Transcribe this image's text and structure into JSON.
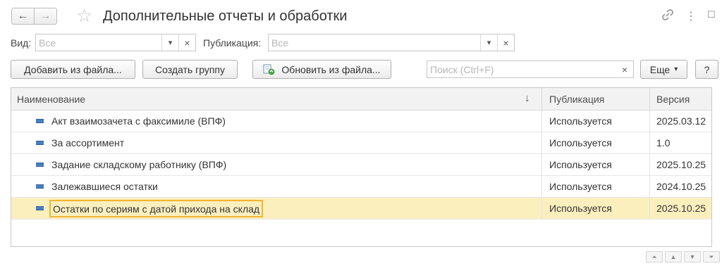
{
  "window": {
    "title": "Дополнительные отчеты и обработки",
    "back_icon": "←",
    "forward_icon": "→",
    "star_icon": "☆",
    "link_icon": "🔗",
    "menu_icon": "⋮",
    "restore_icon": "☐",
    "close_icon": "×"
  },
  "filters": {
    "view_label": "Вид:",
    "view_placeholder": "Все",
    "publication_label": "Публикация:",
    "publication_placeholder": "Все",
    "dropdown_icon": "▾",
    "clear_icon": "×"
  },
  "toolbar": {
    "add_from_file": "Добавить из файла...",
    "create_group": "Создать группу",
    "update_from_file": "Обновить из файла...",
    "search_placeholder": "Поиск (Ctrl+F)",
    "search_clear_icon": "×",
    "more": "Еще",
    "more_arrow": "▾",
    "help": "?"
  },
  "table": {
    "headers": {
      "name": "Наименование",
      "sort_icon": "↓",
      "publication": "Публикация",
      "version": "Версия"
    },
    "rows": [
      {
        "name": "Акт взаимозачета с факсимиле (ВПФ)",
        "publication": "Используется",
        "version": "2025.03.12"
      },
      {
        "name": "За ассортимент",
        "publication": "Используется",
        "version": "1.0"
      },
      {
        "name": "Задание складскому работнику (ВПФ)",
        "publication": "Используется",
        "version": "2025.10.25"
      },
      {
        "name": "Залежавшиеся остатки",
        "publication": "Используется",
        "version": "2024.10.25"
      },
      {
        "name": "Остатки по сериям с датой прихода на склад",
        "publication": "Используется",
        "version": "2025.10.25",
        "selected": true
      }
    ]
  },
  "footer": {
    "first_icon": "⏶",
    "prev_icon": "▲",
    "next_icon": "▼",
    "last_icon": "⏷"
  },
  "colors": {
    "selected_row": "#fbefbe",
    "focus_border": "#f2b532",
    "row_icon": "#4a7fbf"
  }
}
